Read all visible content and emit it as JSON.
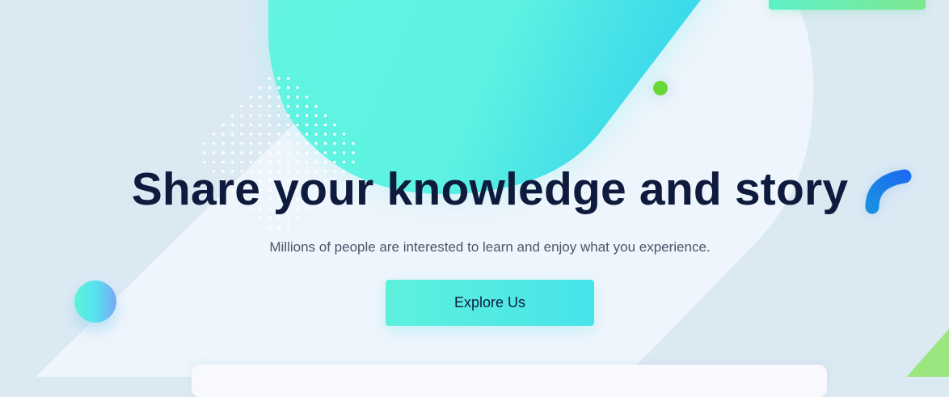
{
  "hero": {
    "title": "Share your knowledge and story",
    "subtitle": "Millions of people are interested to learn and enjoy what you experience.",
    "cta_label": "Explore Us"
  },
  "colors": {
    "background": "#dbe9f3",
    "panel": "#eef5fc",
    "blob_start": "#62f4e1",
    "blob_end": "#3bd8eb",
    "title": "#0f1b3d",
    "subtitle": "#4b5567",
    "button_start": "#5df1dc",
    "button_end": "#47e3ea",
    "accent_green": "#6ad834",
    "accent_blue": "#1a7fe8",
    "corner_green": "#9be67e"
  },
  "decorations": [
    "teal-blob-shape",
    "dot-grid-pattern",
    "green-dot",
    "blue-arc",
    "gradient-circle",
    "corner-triangle"
  ]
}
